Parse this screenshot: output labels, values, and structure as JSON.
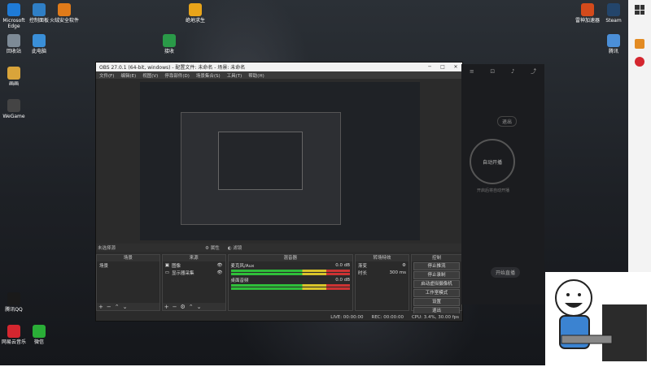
{
  "desktop": {
    "left_icons": [
      {
        "label": "Microsoft Edge",
        "color": "#1f7bd6"
      },
      {
        "label": "控制面板",
        "color": "#2f7fc6"
      },
      {
        "label": "火绒安全软件",
        "color": "#e07b1a"
      },
      {
        "label": "回收站",
        "color": "#7d8a96"
      },
      {
        "label": "此电脑",
        "color": "#3a8fd8"
      },
      {
        "label": "画画",
        "color": "#d9a43a"
      },
      {
        "label": "WeGame",
        "color": "#444"
      },
      {
        "label": "腾讯QQ",
        "color": "#1a1a1a"
      },
      {
        "label": "网易云音乐",
        "color": "#d4262f"
      },
      {
        "label": "微信",
        "color": "#2aae37"
      }
    ],
    "top_icons": [
      {
        "label": "绝地求生",
        "color": "#e8a41a"
      },
      {
        "label": "接收",
        "color": "#2a9a48"
      }
    ],
    "right_icons": [
      {
        "label": "雷神加速器",
        "color": "#d34a1b"
      },
      {
        "label": "Steam",
        "color": "#23456b"
      },
      {
        "label": "腾讯",
        "color": "#4b8fd8"
      }
    ]
  },
  "obs": {
    "title": "OBS 27.0.1 (64-bit, windows) - 配置文件: 未命名 - 场景: 未命名",
    "menu": [
      "文件(F)",
      "编辑(E)",
      "视图(V)",
      "停靠部件(D)",
      "场景集合(S)",
      "工具(T)",
      "帮助(H)"
    ],
    "status_left": "未选择源",
    "status_props": "属性",
    "status_filters": "滤镜",
    "docks": {
      "scenes": {
        "title": "场景",
        "items": [
          "场景"
        ]
      },
      "sources": {
        "title": "来源",
        "items": [
          "图像",
          "显示器采集"
        ]
      },
      "mixer": {
        "title": "混音器",
        "channels": [
          {
            "name": "麦克风/Aux",
            "level": "0.0 dB"
          },
          {
            "name": "桌面音频",
            "level": "0.0 dB"
          }
        ]
      },
      "transitions": {
        "title": "转场特效",
        "value": "渐变",
        "duration_label": "时长",
        "duration": "300 ms"
      },
      "controls": {
        "title": "控制",
        "buttons": [
          "停止推流",
          "停止录制",
          "启动虚拟摄像机",
          "工作室模式",
          "设置",
          "退出"
        ]
      }
    },
    "bottom": {
      "live": "LIVE: 00:00:00",
      "rec": "REC: 00:00:00",
      "cpu": "CPU: 3.4%, 30.00 fps"
    }
  },
  "panel": {
    "exit_label": "退出",
    "circle_label": "自动开播",
    "hint": "开启后将自动开播",
    "btn": "开始直播"
  }
}
